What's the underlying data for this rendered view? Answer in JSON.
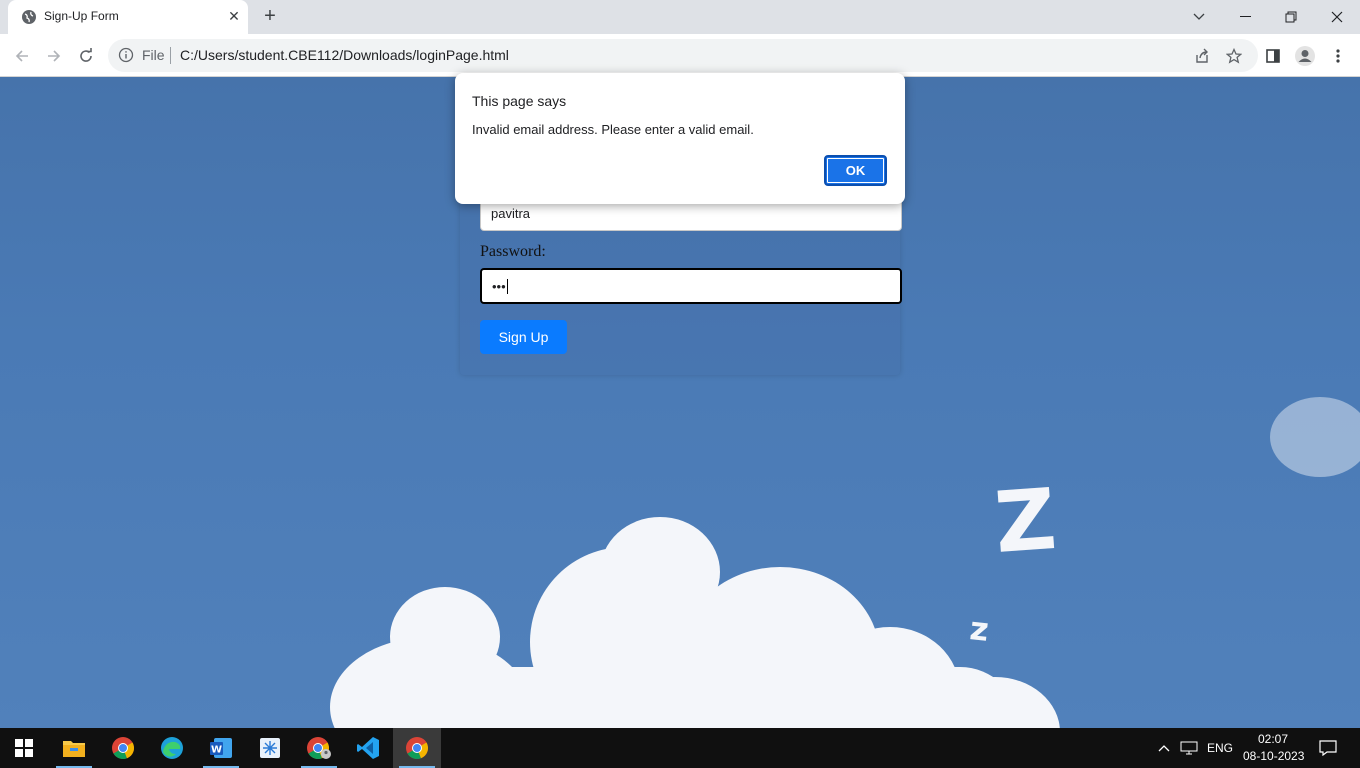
{
  "browser": {
    "tab_title": "Sign-Up Form",
    "address_prefix": "File",
    "url": "C:/Users/student.CBE112/Downloads/loginPage.html"
  },
  "form": {
    "username_value": "pavitra",
    "password_label": "Password:",
    "password_value": "•••",
    "submit_label": "Sign Up"
  },
  "dialog": {
    "title": "This page says",
    "message": "Invalid email address. Please enter a valid email.",
    "ok_label": "OK"
  },
  "taskbar": {
    "language": "ENG",
    "time": "02:07",
    "date": "08-10-2023"
  },
  "colors": {
    "accent": "#1a73e8",
    "signup_button": "#0a7bff",
    "sky": "#4a7ab5"
  }
}
